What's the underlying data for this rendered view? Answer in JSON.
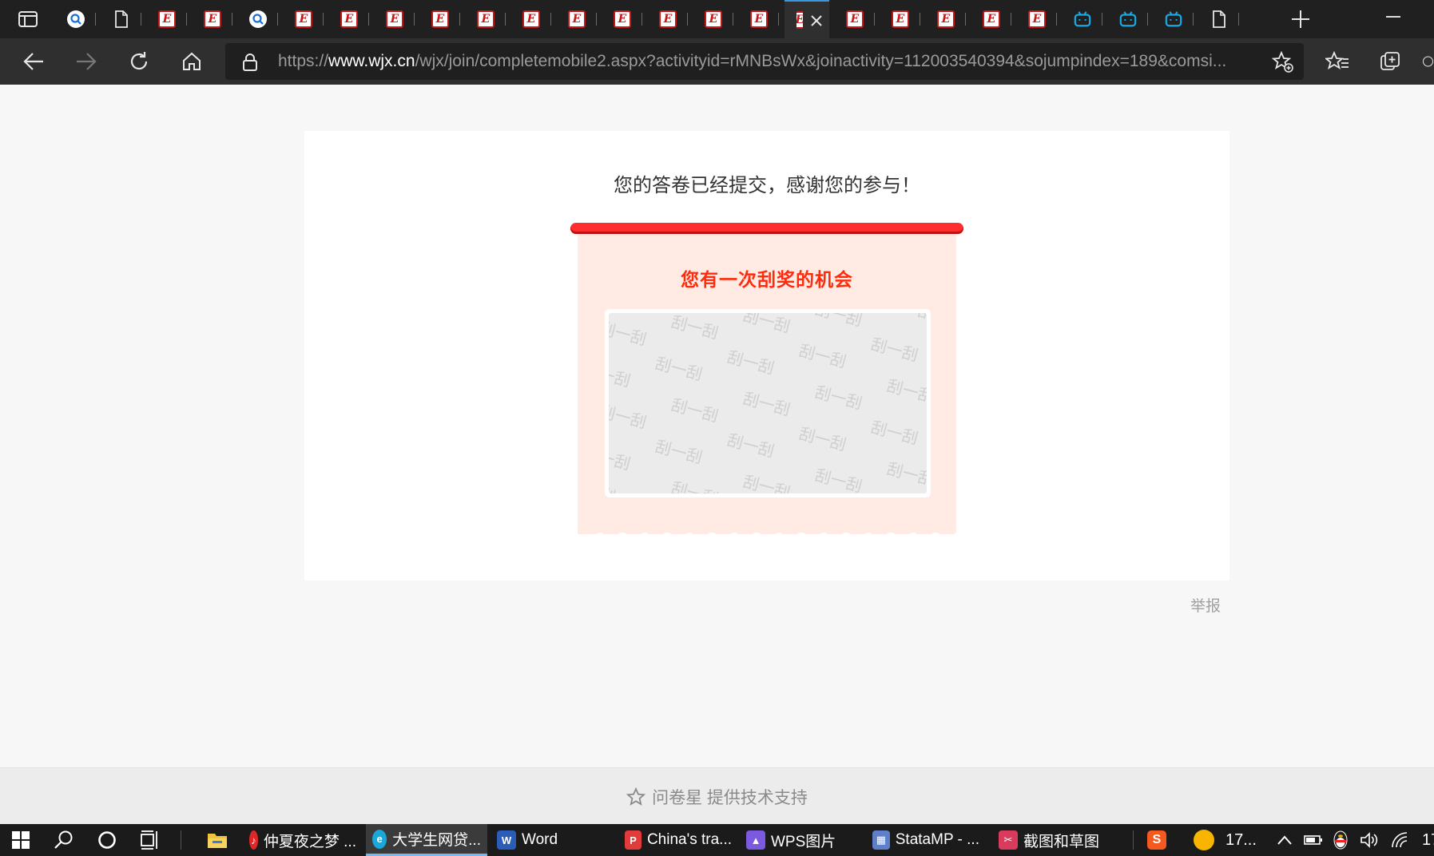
{
  "browser": {
    "tabs": [
      {
        "icon": "search-icon"
      },
      {
        "icon": "page-icon"
      },
      {
        "icon": "e-logo-icon"
      },
      {
        "icon": "e-logo-icon"
      },
      {
        "icon": "search-icon"
      },
      {
        "icon": "e-logo-icon"
      },
      {
        "icon": "e-logo-icon"
      },
      {
        "icon": "e-logo-icon"
      },
      {
        "icon": "e-logo-icon"
      },
      {
        "icon": "e-logo-icon"
      },
      {
        "icon": "e-logo-icon"
      },
      {
        "icon": "e-logo-icon"
      },
      {
        "icon": "e-logo-icon"
      },
      {
        "icon": "e-logo-icon"
      },
      {
        "icon": "e-logo-icon"
      },
      {
        "icon": "e-logo-icon"
      },
      {
        "icon": "e-logo-icon",
        "active": true
      },
      {
        "icon": "e-logo-icon"
      },
      {
        "icon": "e-logo-icon"
      },
      {
        "icon": "e-logo-icon"
      },
      {
        "icon": "e-logo-icon"
      },
      {
        "icon": "e-logo-icon"
      },
      {
        "icon": "bilibili-icon"
      },
      {
        "icon": "bilibili-icon"
      },
      {
        "icon": "bilibili-icon"
      },
      {
        "icon": "page-icon"
      }
    ],
    "url_scheme": "https://",
    "url_host": "www.wjx.cn",
    "url_path": "/wjx/join/completemobile2.aspx?activityid=rMNBsWx&joinactivity=112003540394&sojumpindex=189&comsi..."
  },
  "page": {
    "thanks_message": "您的答卷已经提交，感谢您的参与！",
    "prize_title": "您有一次刮奖的机会",
    "scratch_watermark": "刮一刮",
    "report_link": "举报",
    "footer_text": "问卷星 提供技术支持"
  },
  "taskbar": {
    "apps": [
      {
        "label": "仲夏夜之梦 ...",
        "icon": "netease-music-icon",
        "color": "#e02727"
      },
      {
        "label": "大学生网贷...",
        "icon": "edge-icon",
        "color": "#1aa7d9",
        "active": true
      },
      {
        "label": "Word",
        "icon": "word-icon",
        "color": "#2b5cb8"
      },
      {
        "label": "China's tra...",
        "icon": "wps-pdf-icon",
        "color": "#e23b3b"
      },
      {
        "label": "WPS图片",
        "icon": "wps-picture-icon",
        "color": "#7b5ae0"
      },
      {
        "label": "StataMP - ...",
        "icon": "stata-icon",
        "color": "#5f7fc9"
      },
      {
        "label": "截图和草图",
        "icon": "snip-sketch-icon",
        "color": "#d83b5c"
      }
    ],
    "tray_weather": "17...",
    "clock_partial": "17"
  },
  "colors": {
    "accent_red": "#ff2b0d",
    "ticket_bg": "#ffebe3",
    "tab_active_indicator": "#3a96dd"
  }
}
